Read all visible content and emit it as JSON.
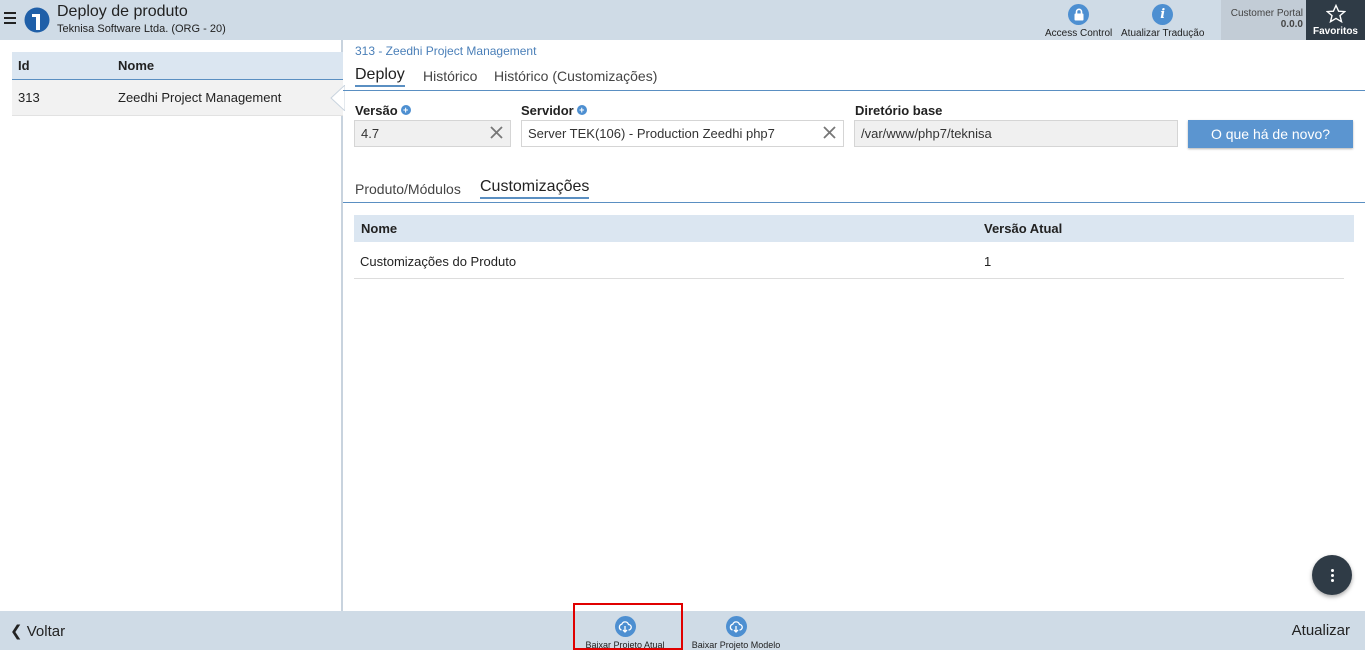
{
  "header": {
    "title": "Deploy de produto",
    "subtitle": "Teknisa Software Ltda. (ORG - 20)",
    "actions": [
      {
        "label": "Access Control",
        "icon": "lock-icon"
      },
      {
        "label": "Atualizar Tradução",
        "icon": "info-icon"
      }
    ],
    "portal_label": "Customer Portal",
    "portal_version": "0.0.0",
    "favorites_label": "Favoritos"
  },
  "left_grid": {
    "columns": [
      "Id",
      "Nome"
    ],
    "rows": [
      {
        "id": "313",
        "name": "Zeedhi Project Management"
      }
    ]
  },
  "breadcrumb": "313 - Zeedhi Project Management",
  "tabs": [
    {
      "label": "Deploy",
      "active": true
    },
    {
      "label": "Histórico",
      "active": false
    },
    {
      "label": "Histórico (Customizações)",
      "active": false
    }
  ],
  "form": {
    "versao_label": "Versão",
    "versao_value": "4.7",
    "servidor_label": "Servidor",
    "servidor_value": "Server TEK(106) - Production Zeedhi php7",
    "diretorio_label": "Diretório base",
    "diretorio_value": "/var/www/php7/teknisa",
    "news_button": "O que há de novo?"
  },
  "sub_tabs": [
    {
      "label": "Produto/Módulos",
      "active": false
    },
    {
      "label": "Customizações",
      "active": true
    }
  ],
  "table": {
    "columns": [
      "Nome",
      "Versão Atual"
    ],
    "rows": [
      {
        "nome": "Customizações do Produto",
        "versao": "1"
      }
    ]
  },
  "footer": {
    "back_label": "Voltar",
    "refresh_label": "Atualizar",
    "actions": [
      {
        "label": "Baixar Projeto Atual",
        "icon": "cloud-download-icon"
      },
      {
        "label": "Baixar Projeto Modelo",
        "icon": "cloud-download-icon"
      }
    ]
  },
  "colors": {
    "header_bg": "#cfdbe6",
    "accent": "#4d8fd1",
    "favorites_bg": "#2f3b46",
    "highlight": "#e00000"
  }
}
